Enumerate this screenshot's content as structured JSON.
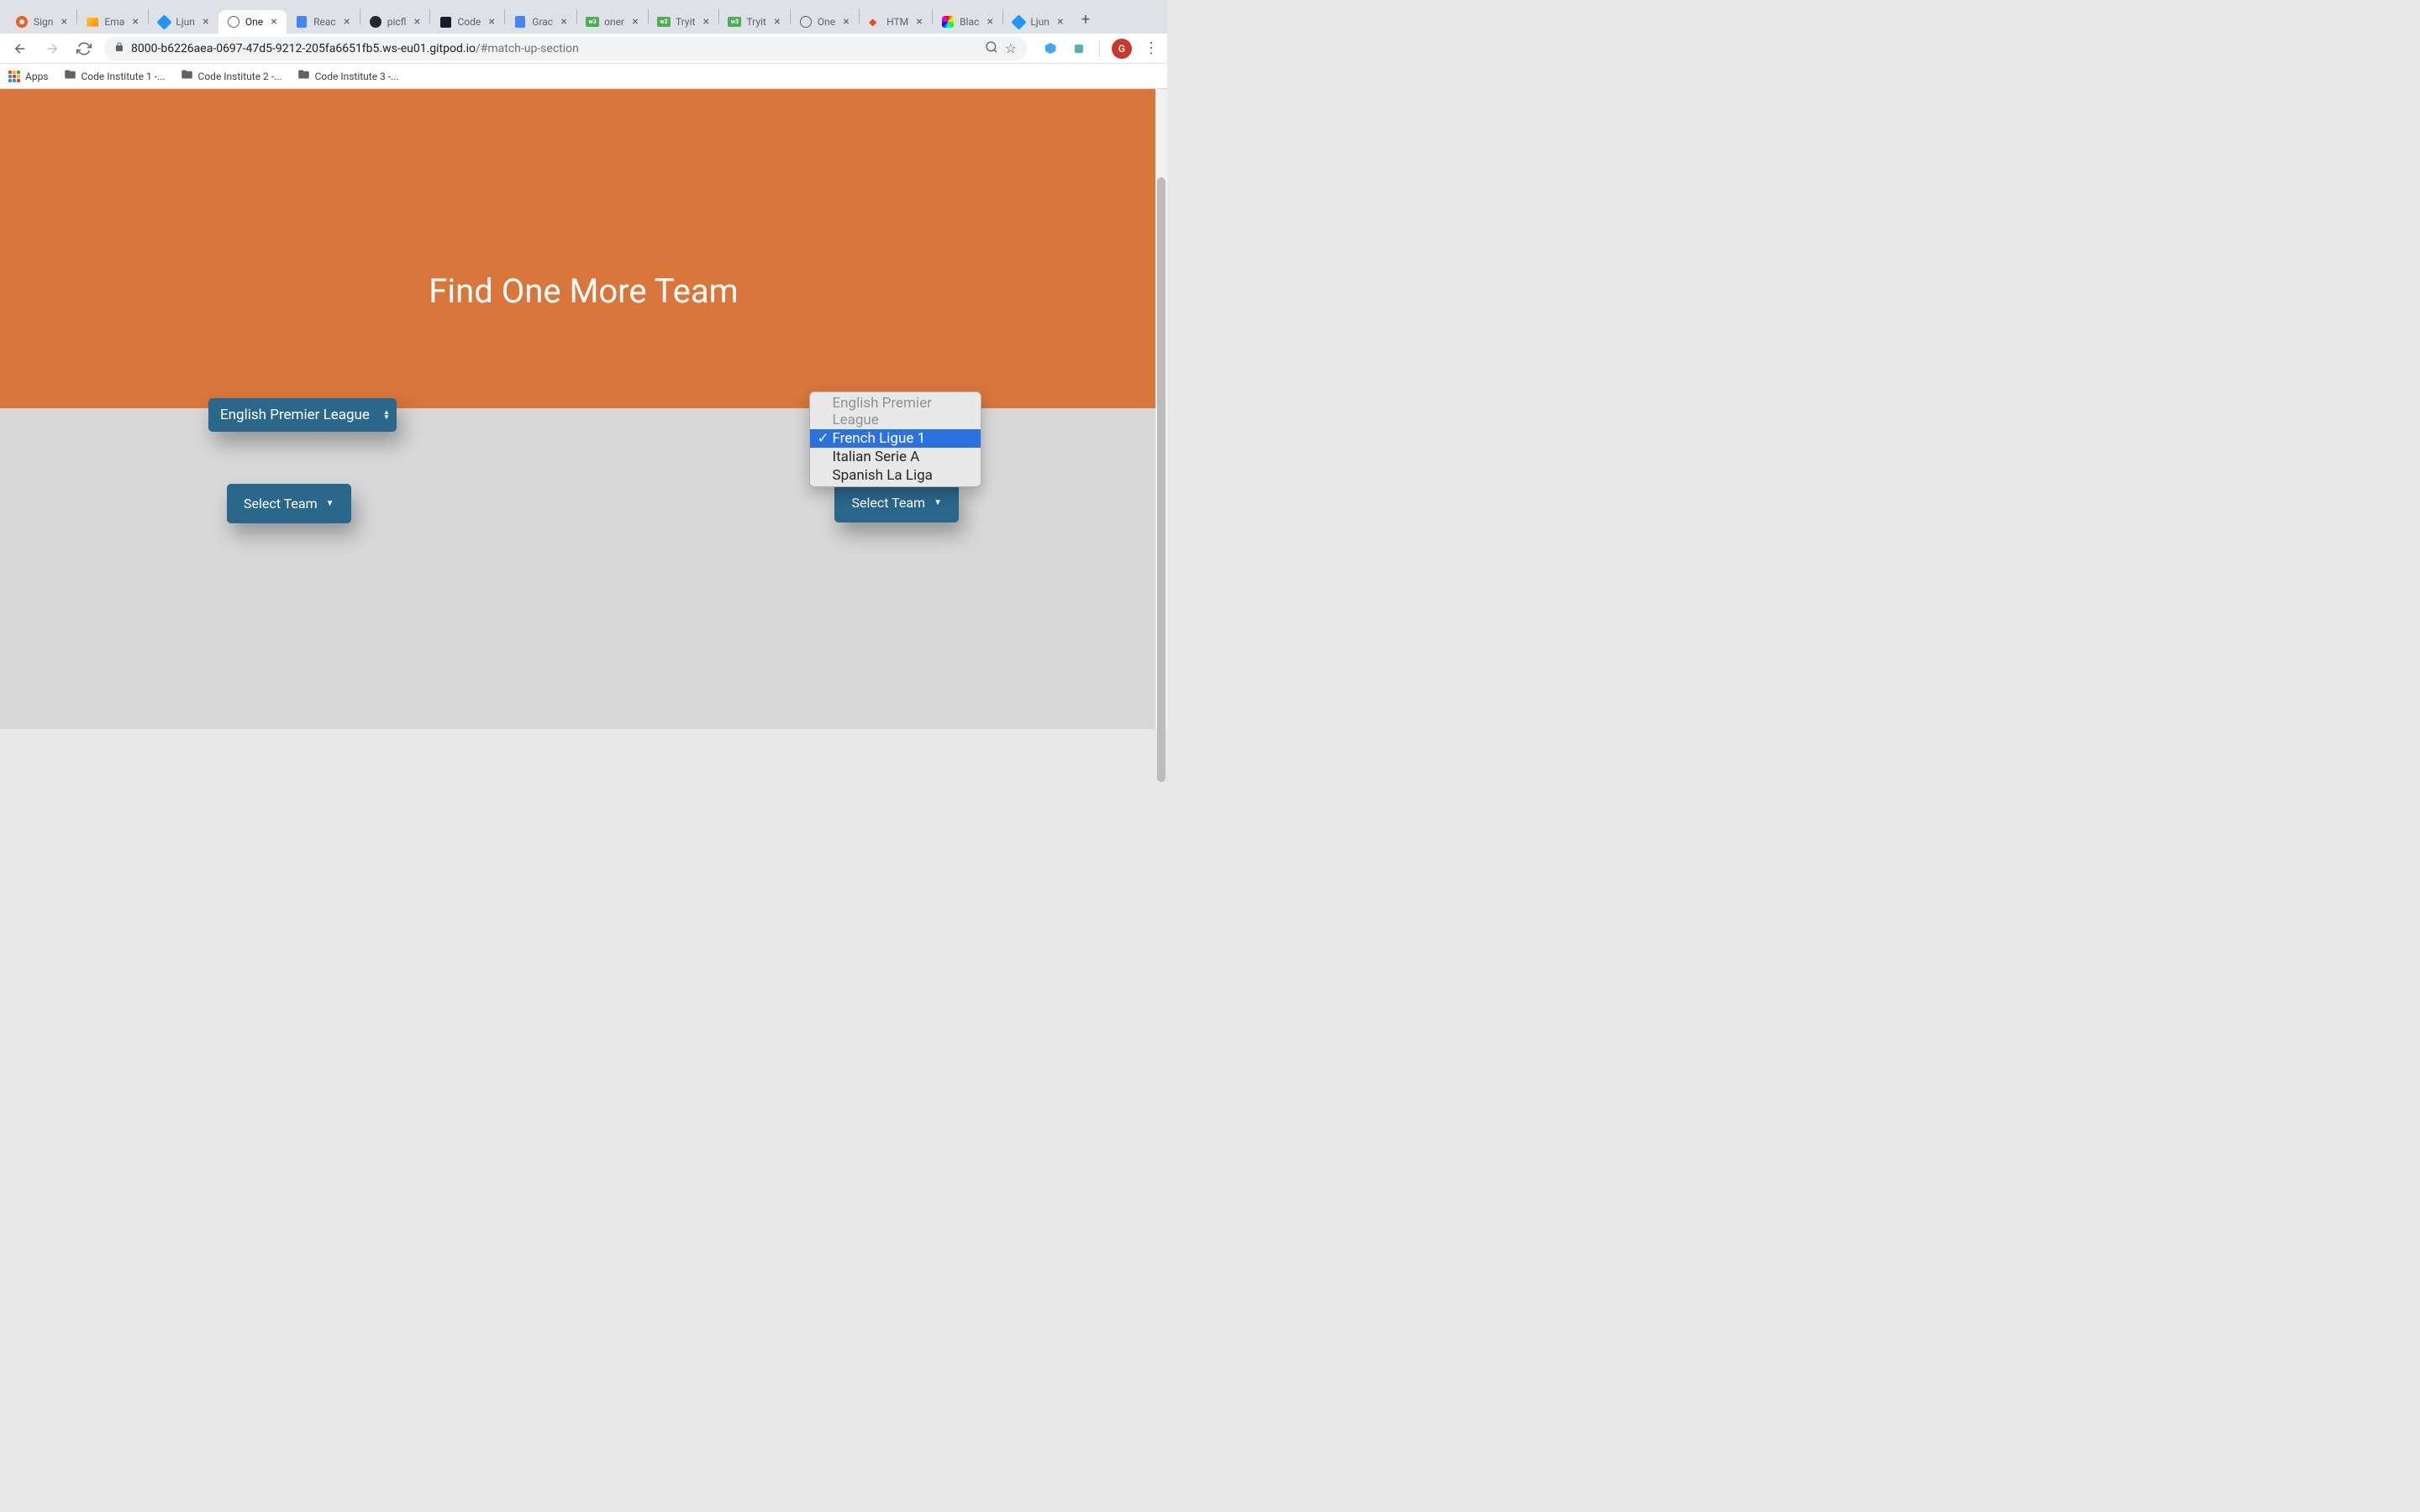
{
  "browser": {
    "tabs": [
      {
        "title": "Sign",
        "favType": "orange"
      },
      {
        "title": "Ema",
        "favType": "mail"
      },
      {
        "title": "Ljun",
        "favType": "blue-cube"
      },
      {
        "title": "One",
        "favType": "globe",
        "active": true
      },
      {
        "title": "Reac",
        "favType": "docs"
      },
      {
        "title": "picfl",
        "favType": "github"
      },
      {
        "title": "Code",
        "favType": "square-dark"
      },
      {
        "title": "Grac",
        "favType": "docs"
      },
      {
        "title": "oner",
        "favType": "w3"
      },
      {
        "title": "Tryit",
        "favType": "w3"
      },
      {
        "title": "Tryit",
        "favType": "w3"
      },
      {
        "title": "One",
        "favType": "globe"
      },
      {
        "title": "HTM",
        "favType": "html"
      },
      {
        "title": "Blac",
        "favType": "color"
      },
      {
        "title": "Ljun",
        "favType": "blue-cube"
      }
    ],
    "url_domain": "8000-b6226aea-0697-47d5-9212-205fa6651fb5.ws-eu01.gitpod.io",
    "url_path": "/#match-up-section",
    "profile_initial": "G"
  },
  "bookmarks": {
    "apps_label": "Apps",
    "folders": [
      "Code Institute 1 -...",
      "Code Institute 2 -...",
      "Code Institute 3 -..."
    ]
  },
  "page": {
    "hero_title": "Find One More Team",
    "left_league_selected": "English Premier League",
    "select_team_label": "Select Team",
    "dropdown_options": [
      {
        "label": "English Premier League",
        "state": "disabled"
      },
      {
        "label": "French Ligue 1",
        "state": "highlighted"
      },
      {
        "label": "Italian Serie A",
        "state": "normal"
      },
      {
        "label": "Spanish La Liga",
        "state": "normal"
      }
    ]
  }
}
